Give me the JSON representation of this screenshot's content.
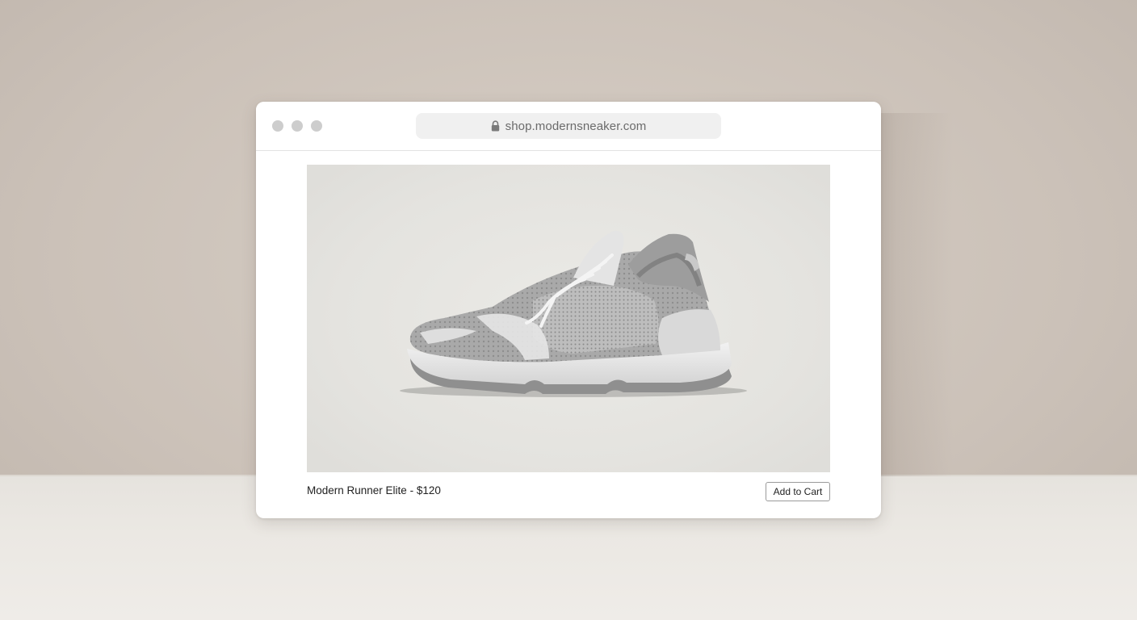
{
  "browser": {
    "url": "shop.modernsneaker.com",
    "lock_icon": "lock-icon",
    "window_controls": [
      "close",
      "minimize",
      "maximize"
    ]
  },
  "product": {
    "name": "Modern Runner Elite",
    "separator": " - ",
    "price": "$120",
    "image_icon": "sneaker-image"
  },
  "actions": {
    "add_to_cart_label": "Add to Cart"
  },
  "colors": {
    "background_wall": "#cfc6bd",
    "window": "#ffffff",
    "url_bar": "#f0f0f0",
    "window_dot": "#cdcdcd",
    "product_backdrop": "#e4e3df"
  }
}
